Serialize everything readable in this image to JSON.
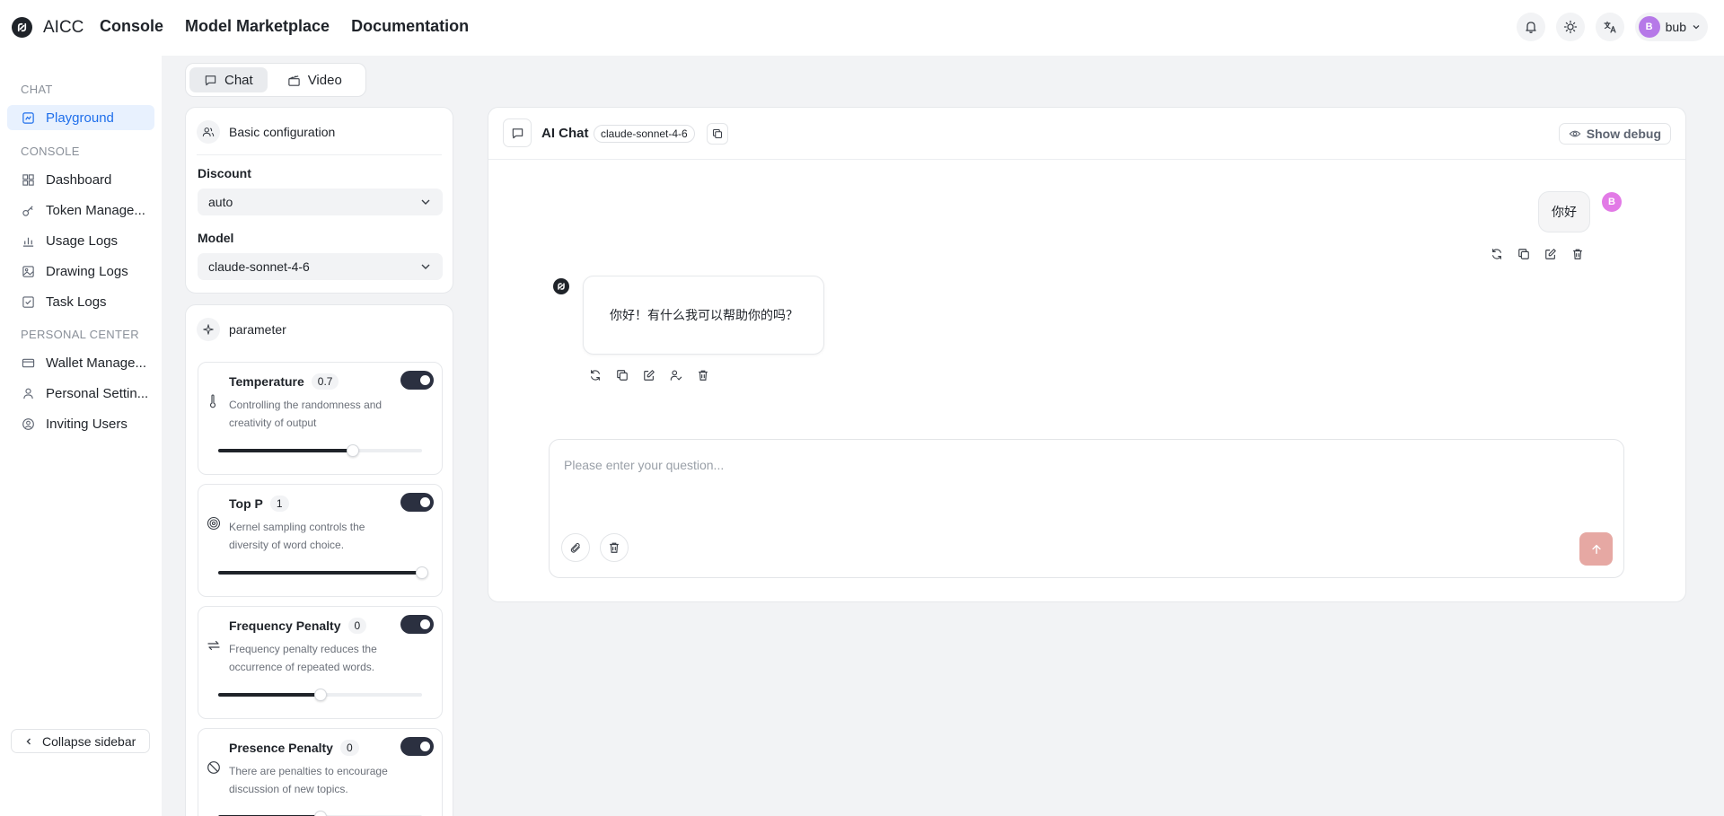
{
  "brand": {
    "name": "AICC"
  },
  "topnav": {
    "console": "Console",
    "marketplace": "Model Marketplace",
    "documentation": "Documentation"
  },
  "user": {
    "avatar_letter": "B",
    "name": "bub"
  },
  "sidebar": {
    "sections": {
      "chat": "CHAT",
      "console": "CONSOLE",
      "personal": "PERSONAL CENTER"
    },
    "items": {
      "playground": "Playground",
      "dashboard": "Dashboard",
      "token": "Token Manage...",
      "usage": "Usage Logs",
      "drawing": "Drawing Logs",
      "task": "Task Logs",
      "wallet": "Wallet Manage...",
      "personal_settings": "Personal Settin...",
      "inviting": "Inviting Users"
    },
    "collapse_label": "Collapse sidebar"
  },
  "modes": {
    "chat": "Chat",
    "video": "Video"
  },
  "basic_config": {
    "title": "Basic configuration",
    "discount_label": "Discount",
    "discount_value": "auto",
    "model_label": "Model",
    "model_value": "claude-sonnet-4-6"
  },
  "parameters": {
    "title": "parameter",
    "temperature": {
      "label": "Temperature",
      "value": "0.7",
      "desc": "Controlling the randomness and creativity of output",
      "fraction": 0.66
    },
    "top_p": {
      "label": "Top P",
      "value": "1",
      "desc": "Kernel sampling controls the diversity of word choice.",
      "fraction": 1.0
    },
    "frequency_penalty": {
      "label": "Frequency Penalty",
      "value": "0",
      "desc": "Frequency penalty reduces the occurrence of repeated words.",
      "fraction": 0.5
    },
    "presence_penalty": {
      "label": "Presence Penalty",
      "value": "0",
      "desc": "There are penalties to encourage discussion of new topics.",
      "fraction": 0.5
    }
  },
  "chat": {
    "title": "AI Chat",
    "model_chip": "claude-sonnet-4-6",
    "debug_label": "Show debug",
    "user_message": "你好",
    "user_avatar_letter": "B",
    "bot_message": "你好！有什么我可以帮助你的吗？",
    "input_placeholder": "Please enter your question..."
  },
  "colors": {
    "accent": "#1f6feb",
    "active_bg": "#e8f1fe",
    "toggle": "#2b3040",
    "send_button": "#e6a8a3",
    "user_avatar": "#e27ae6"
  }
}
